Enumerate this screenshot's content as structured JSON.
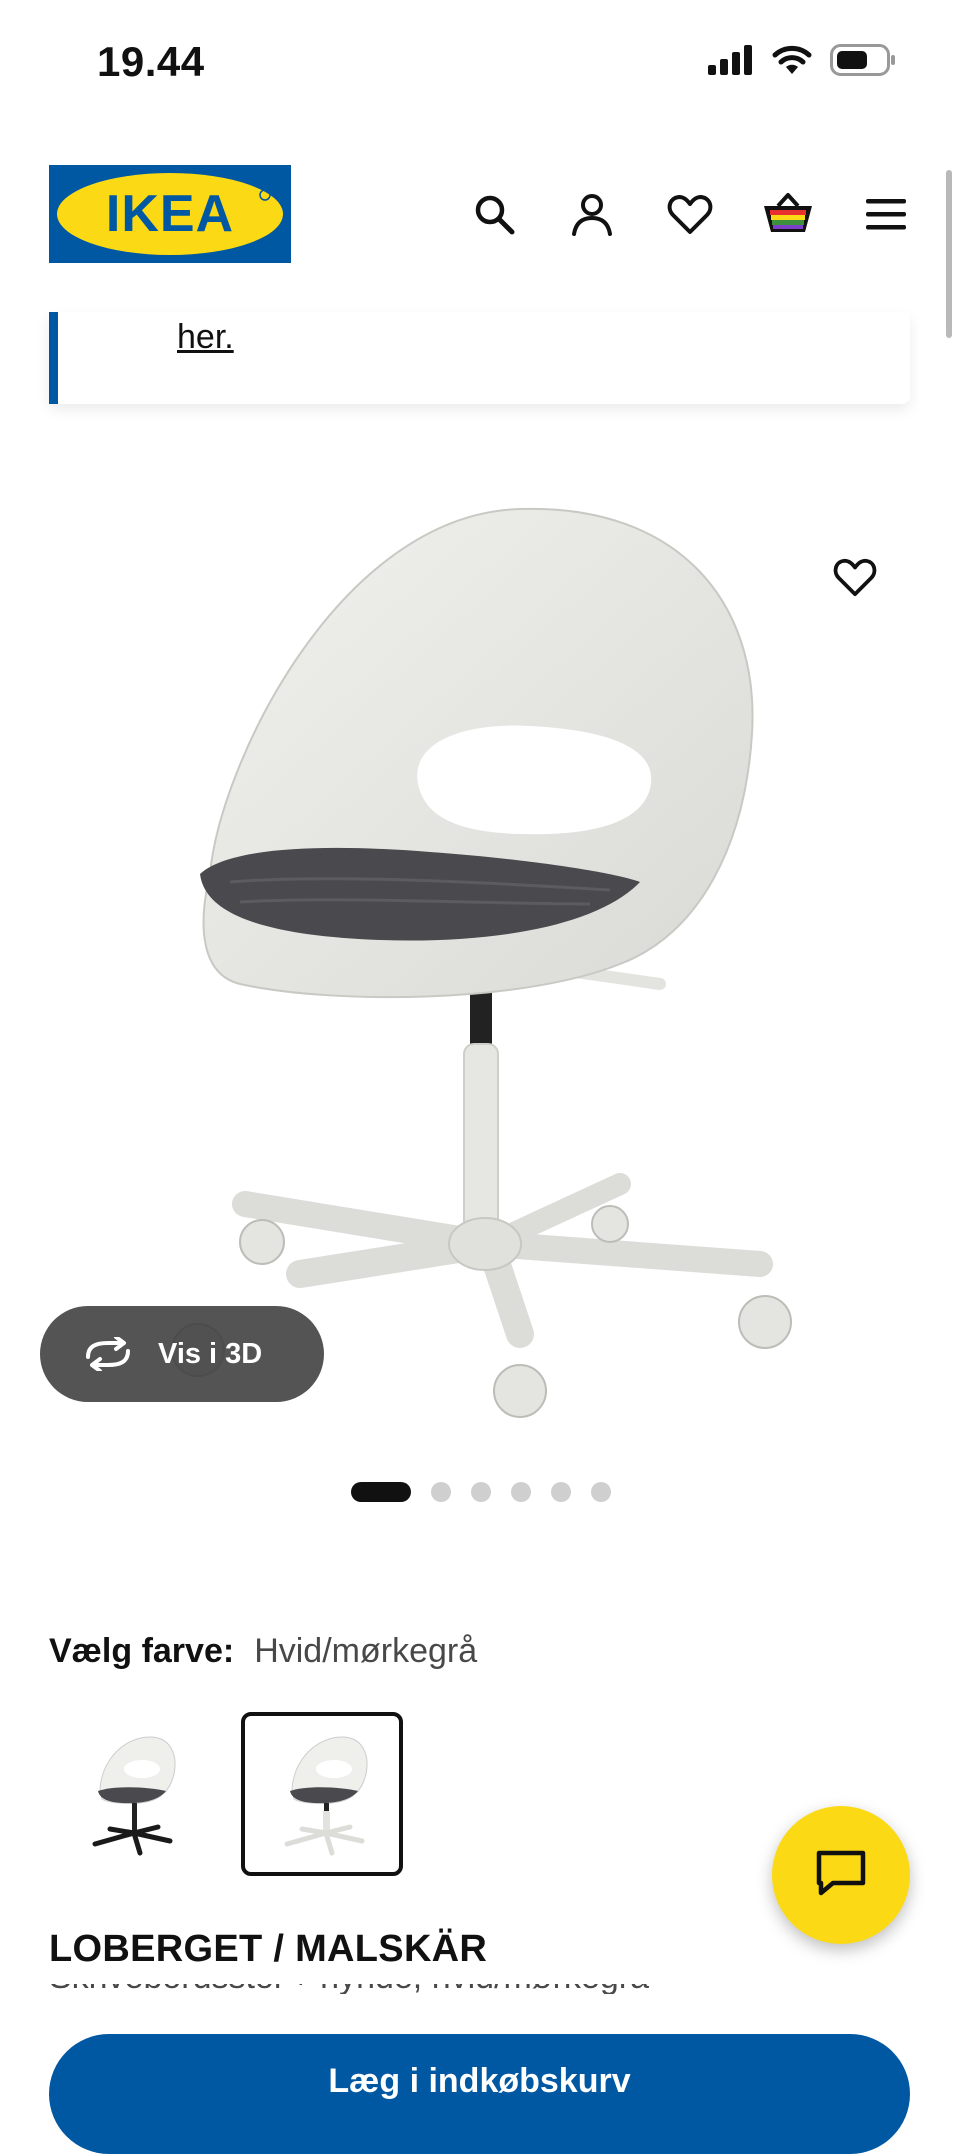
{
  "status_bar": {
    "time": "19.44",
    "icons": [
      "signal-icon",
      "wifi-icon",
      "battery-icon"
    ]
  },
  "header": {
    "logo_text": "IKEA",
    "icons": [
      "search-icon",
      "account-icon",
      "heart-icon",
      "basket-icon",
      "menu-icon"
    ]
  },
  "notice": {
    "link_text": "her."
  },
  "gallery": {
    "view_3d_label": "Vis i 3D",
    "image_count": 6,
    "active_index": 0
  },
  "color": {
    "label": "Vælg farve:",
    "value": "Hvid/mørkegrå",
    "options": [
      "black-base",
      "white-base"
    ],
    "selected_index": 1
  },
  "product": {
    "name": "LOBERGET / MALSKÄR",
    "description": "Skrivebordsstol + hynde, hvid/mørkegrå"
  },
  "cart_button": {
    "label": "Læg i indkøbskurv"
  },
  "colors": {
    "ikea_blue": "#0058a3",
    "ikea_yellow": "#fbd914"
  }
}
